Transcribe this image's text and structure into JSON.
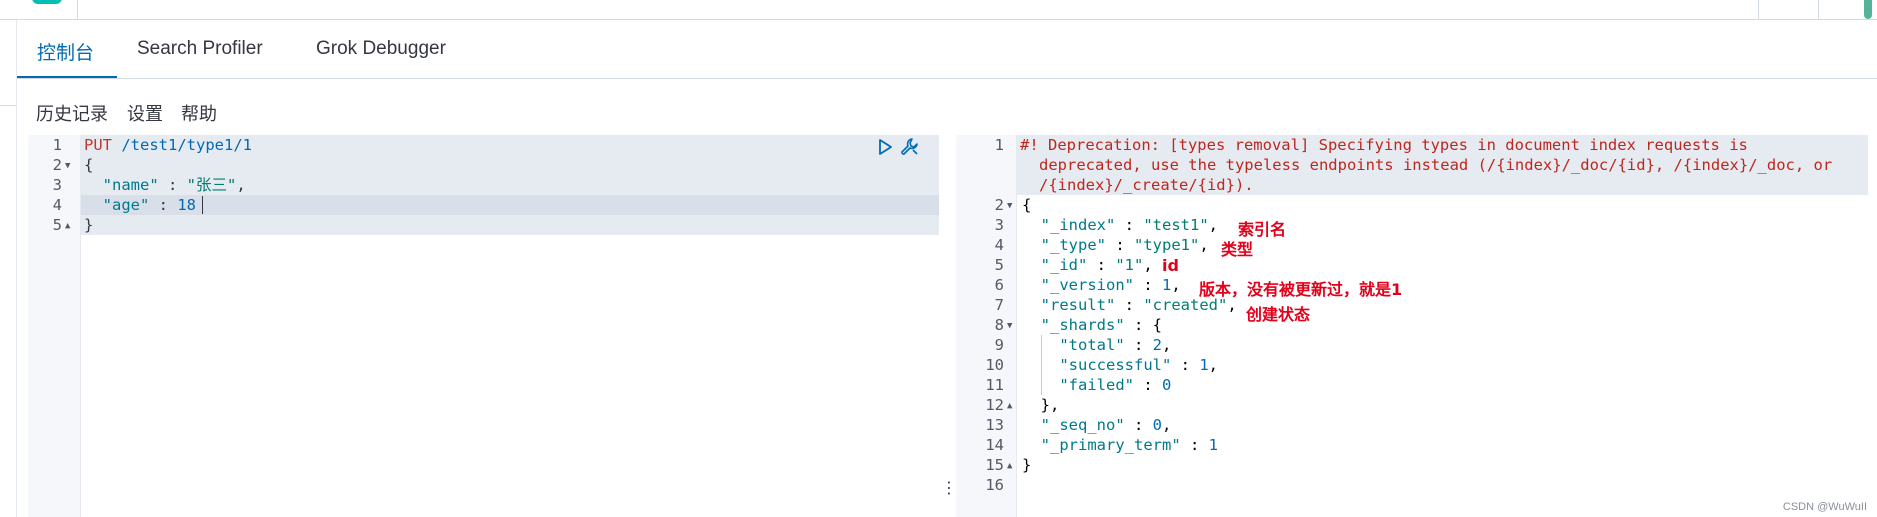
{
  "tabs": [
    {
      "label": "控制台",
      "active": true
    },
    {
      "label": "Search Profiler",
      "active": false
    },
    {
      "label": "Grok Debugger",
      "active": false
    }
  ],
  "submenu": {
    "history": "历史记录",
    "settings": "设置",
    "help": "帮助"
  },
  "request": {
    "line1_method": "PUT",
    "line1_path": "/test1/type1/1",
    "line2": "{",
    "line3_key": "\"name\"",
    "line3_sep": " : ",
    "line3_val": "\"张三\"",
    "line3_end": ",",
    "line4_key": "\"age\"",
    "line4_sep": " : ",
    "line4_val": "18",
    "line5": "}"
  },
  "response": {
    "dep1": "#! Deprecation: [types removal] Specifying types in document index requests is",
    "dep2": "deprecated, use the typeless endpoints instead (/{index}/_doc/{id}, /{index}/_doc, or",
    "dep3": "/{index}/_create/{id}).",
    "l2": "{",
    "index_key": "\"_index\"",
    "index_val": "\"test1\"",
    "type_key": "\"_type\"",
    "type_val": "\"type1\"",
    "id_key": "\"_id\"",
    "id_val": "\"1\"",
    "version_key": "\"_version\"",
    "version_val": "1",
    "result_key": "\"result\"",
    "result_val": "\"created\"",
    "shards_key": "\"_shards\"",
    "total_key": "\"total\"",
    "total_val": "2",
    "successful_key": "\"successful\"",
    "successful_val": "1",
    "failed_key": "\"failed\"",
    "failed_val": "0",
    "shards_close": "},",
    "seq_key": "\"_seq_no\"",
    "seq_val": "0",
    "primary_key": "\"_primary_term\"",
    "primary_val": "1",
    "l15": "}",
    "sep": " : ",
    "comma": ",",
    "open_brace": "{"
  },
  "annotations": {
    "index": "索引名",
    "type": "类型",
    "id": "id",
    "version": "版本，没有被更新过，就是1",
    "result": "创建状态"
  },
  "left_line_numbers": [
    "1",
    "2",
    "3",
    "4",
    "5"
  ],
  "right_line_numbers": [
    "1",
    "2",
    "3",
    "4",
    "5",
    "6",
    "7",
    "8",
    "9",
    "10",
    "11",
    "12",
    "13",
    "14",
    "15",
    "16"
  ],
  "watermark": "CSDN @WuWuII",
  "colors": {
    "accent": "#006bb4",
    "annotation": "#e3001b",
    "warning": "#bd271e"
  }
}
